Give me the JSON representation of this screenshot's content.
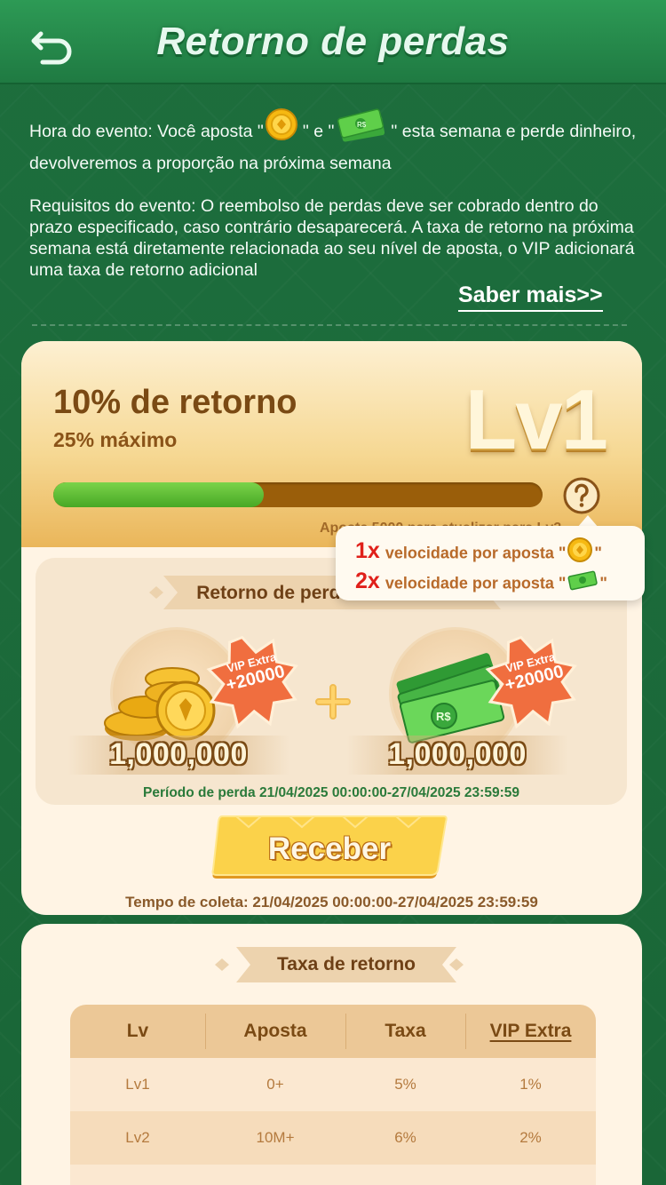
{
  "header": {
    "title": "Retorno de perdas",
    "back_icon": "back-arrow-icon"
  },
  "intro": {
    "event_time_part1": "Hora do evento: Você aposta \"",
    "event_time_part2": "\" e \"",
    "event_time_part3": "\" esta semana e perde dinheiro, devolveremos a proporção na próxima semana",
    "requirements": "Requisitos do evento: O reembolso de perdas deve ser cobrado dentro do prazo especificado, caso contrário desaparecerá. A taxa de retorno na próxima semana está diretamente relacionada ao seu nível de aposta, o VIP adicionará uma taxa de retorno adicional",
    "learn_more": "Saber mais>>"
  },
  "level_card": {
    "return_rate": "10% de retorno",
    "max_rate": "25% máximo",
    "level": "Lv1",
    "progress": 0.43,
    "upgrade_text": "Aposte 5000 para atualizar para Lv2",
    "help_icon": "question-icon"
  },
  "reward_panel": {
    "ribbon_title": "Retorno de perdas",
    "coin": {
      "amount": "1,000,000",
      "vip_label": "VIP Extra",
      "vip_amount": "+20000"
    },
    "cash": {
      "amount": "1,000,000",
      "vip_label": "VIP Extra",
      "vip_amount": "+20000"
    },
    "plus": "+",
    "loss_period": "Período de perda 21/04/2025 00:00:00-27/04/2025 23:59:59"
  },
  "receive_button": "Receber",
  "collect_time": "Tempo de coleta: 21/04/2025 00:00:00-27/04/2025 23:59:59",
  "tooltip": {
    "rows": [
      {
        "mult": "1x",
        "text": "velocidade por aposta \"",
        "end": "\""
      },
      {
        "mult": "2x",
        "text": "velocidade por aposta \"",
        "end": "\""
      }
    ]
  },
  "rate_table": {
    "title": "Taxa de retorno",
    "headers": [
      "Lv",
      "Aposta",
      "Taxa",
      "VIP Extra"
    ],
    "rows": [
      [
        "Lv1",
        "0+",
        "5%",
        "1%"
      ],
      [
        "Lv2",
        "10M+",
        "6%",
        "2%"
      ]
    ]
  },
  "colors": {
    "background_green": "#1a6a3a",
    "header_green": "#2d9a55",
    "gold_text": "#7a4a14",
    "progress_green": "#47a825",
    "progress_track": "#9a5e0a",
    "button_gold": "#f7c437",
    "multiplier_red": "#e0201a"
  }
}
